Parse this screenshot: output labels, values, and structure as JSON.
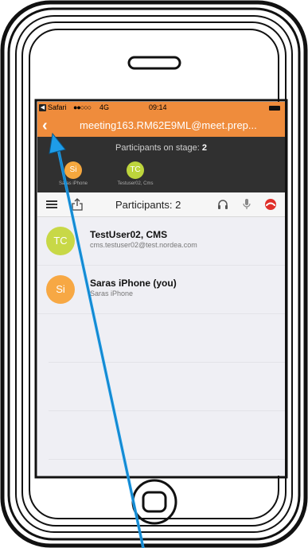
{
  "status_bar": {
    "back_app": "Safari",
    "signal": "●●○○○",
    "network": "4G",
    "time": "09:14"
  },
  "nav": {
    "back_glyph": "‹",
    "title": "meeting163.RM62E9ML@meet.prep..."
  },
  "stage": {
    "label": "Participants on stage:",
    "count": "2",
    "people": [
      {
        "initials": "Si",
        "name": "Saras iPhone",
        "color": "#f5a73e"
      },
      {
        "initials": "TC",
        "name": "Testuser02, Cms",
        "color": "#bdd53c"
      }
    ]
  },
  "toolbar": {
    "title": "Participants: 2"
  },
  "participants": [
    {
      "initials": "TC",
      "name": "TestUser02, CMS",
      "subtitle": "cms.testuser02@test.nordea.com",
      "color": "#c8d847"
    },
    {
      "initials": "Si",
      "name": "Saras iPhone (you)",
      "subtitle": "Saras iPhone",
      "color": "#f7a844"
    }
  ],
  "colors": {
    "accent": "#ef8c3c",
    "stage_bg": "#303030",
    "hangup": "#e0302a",
    "annotation_arrow": "#1e9ce8"
  }
}
